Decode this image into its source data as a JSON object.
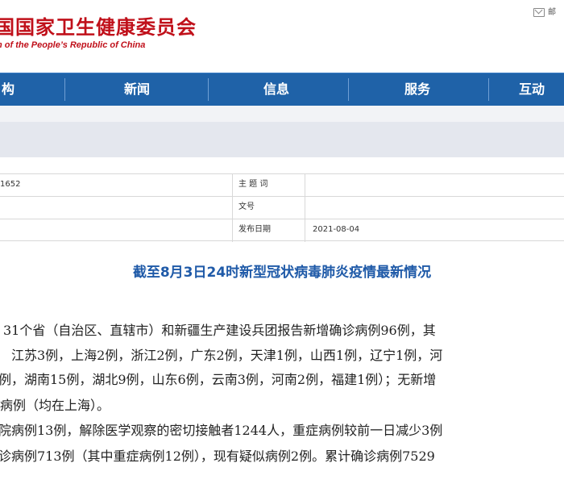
{
  "header": {
    "title": "国国家卫生健康委员会",
    "subtitle": "n of the People’s Republic of China",
    "mail_label": "邮"
  },
  "nav": {
    "items": [
      {
        "label": "构"
      },
      {
        "label": "新闻"
      },
      {
        "label": "信息"
      },
      {
        "label": "服务"
      },
      {
        "label": "互动"
      }
    ]
  },
  "meta": {
    "index_value": "1652",
    "subject_label": "主 题 词",
    "subject_value": "",
    "docno_label": "文号",
    "docno_value": "",
    "date_label": "发布日期",
    "date_value": "2021-08-04"
  },
  "article": {
    "title": "截至8月3日24时新型冠状病毒肺炎疫情最新情况",
    "lines": [
      "31个省（自治区、直辖市）和新疆生产建设兵团报告新增确诊病例96例，其",
      "江苏3例，上海2例，浙江2例，广东2例，天津1例，山西1例，辽宁1例，河",
      "例，湖南15例，湖北9例，山东6例，云南3例，河南2例，福建1例）；无新增",
      "病例（均在上海）。",
      "院病例13例，解除医学观察的密切接触者1244人，重症病例较前一日减少3例",
      "诊病例713例（其中重症病例12例），现有疑似病例2例。累计确诊病例7529"
    ]
  },
  "colors": {
    "brand_red": "#c0101a",
    "nav_blue": "#1f62a8",
    "title_blue": "#1f5aa8"
  }
}
